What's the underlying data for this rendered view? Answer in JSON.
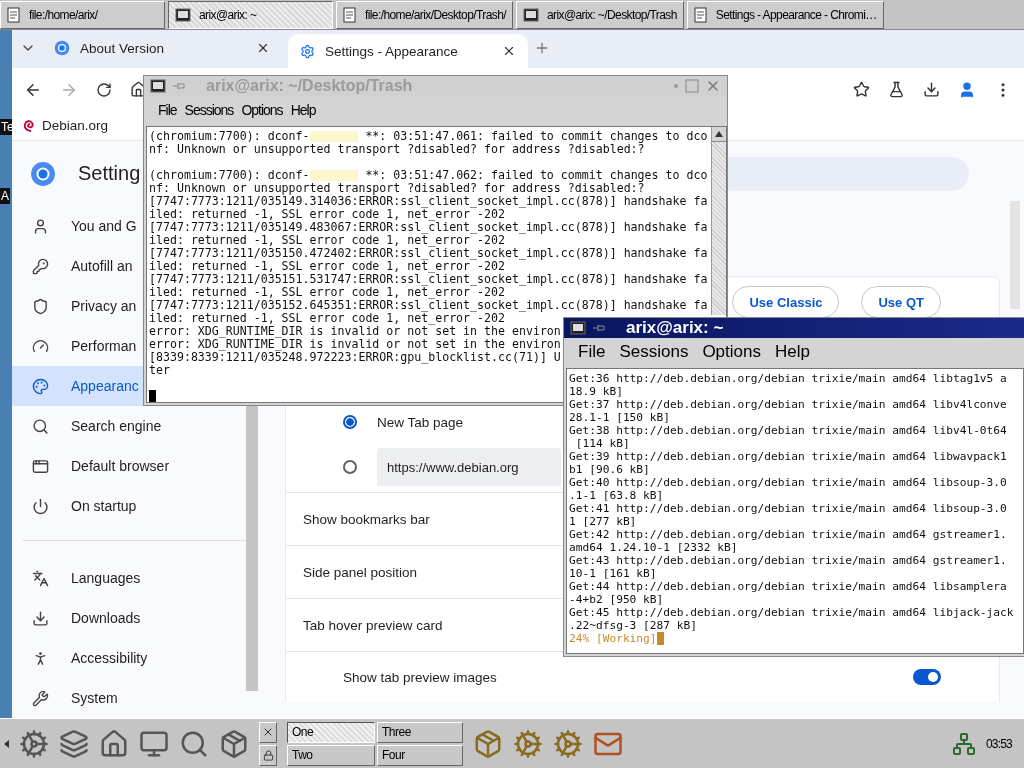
{
  "taskbar_top": {
    "tasks": [
      {
        "label": "file:/home/arix/",
        "selected": false
      },
      {
        "label": "arix@arix: ~",
        "selected": true
      },
      {
        "label": "file:/home/arix/Desktop/Trash/",
        "selected": false
      },
      {
        "label": "arix@arix: ~/Desktop/Trash",
        "selected": false
      },
      {
        "label": "Settings - Appearance - Chromi…",
        "selected": false
      }
    ]
  },
  "desktop_labels": [
    "Te",
    "A"
  ],
  "browser": {
    "tabs": [
      {
        "label": "About Version",
        "selected": false
      },
      {
        "label": "Settings - Appearance",
        "selected": true
      }
    ],
    "bookmarks": [
      "Debian.org"
    ],
    "settings": {
      "title": "Setting",
      "sidebar": [
        {
          "label": "You and G",
          "selected": false
        },
        {
          "label": "Autofill an",
          "selected": false
        },
        {
          "label": "Privacy an",
          "selected": false
        },
        {
          "label": "Performan",
          "selected": false
        },
        {
          "label": "Appearanc",
          "selected": true
        },
        {
          "label": "Search engine",
          "selected": false
        },
        {
          "label": "Default browser",
          "selected": false
        },
        {
          "label": "On startup",
          "selected": false
        },
        {
          "label": "Languages",
          "selected": false
        },
        {
          "label": "Downloads",
          "selected": false
        },
        {
          "label": "Accessibility",
          "selected": false
        },
        {
          "label": "System",
          "selected": false
        }
      ],
      "theme_buttons": [
        "Use Classic",
        "Use QT"
      ],
      "startup_options": [
        {
          "kind": "preset",
          "label": "New Tab page",
          "selected": true
        },
        {
          "kind": "url",
          "value": "https://www.debian.org",
          "selected": false
        }
      ],
      "rows": [
        {
          "kind": "plain",
          "label": "Show bookmarks bar"
        },
        {
          "kind": "plain",
          "label": "Side panel position"
        },
        {
          "kind": "plain",
          "label": "Tab hover preview card"
        },
        {
          "kind": "toggle",
          "label": "Show tab preview images",
          "on": true
        }
      ]
    }
  },
  "terminals": [
    {
      "title": "arix@arix: ~/Desktop/Trash",
      "active": false,
      "menu": [
        "File",
        "Sessions",
        "Options",
        "Help"
      ],
      "lines": [
        {
          "kind": "redacted",
          "before": "(chromium:7700): dconf-",
          "after": " **: 03:51:47.061: failed to commit changes to dco"
        },
        {
          "kind": "plain",
          "text": "nf: Unknown or unsupported transport ?disabled? for address ?disabled:?"
        },
        {
          "kind": "blank"
        },
        {
          "kind": "redacted",
          "before": "(chromium:7700): dconf-",
          "after": " **: 03:51:47.062: failed to commit changes to dco"
        },
        {
          "kind": "plain",
          "text": "nf: Unknown or unsupported transport ?disabled? for address ?disabled:?"
        },
        {
          "kind": "plain",
          "text": "[7747:7773:1211/035149.314036:ERROR:ssl_client_socket_impl.cc(878)] handshake fa"
        },
        {
          "kind": "plain",
          "text": "iled: returned -1, SSL error code 1, net_error -202"
        },
        {
          "kind": "plain",
          "text": "[7747:7773:1211/035149.483067:ERROR:ssl_client_socket_impl.cc(878)] handshake fa"
        },
        {
          "kind": "plain",
          "text": "iled: returned -1, SSL error code 1, net_error -202"
        },
        {
          "kind": "plain",
          "text": "[7747:7773:1211/035150.472402:ERROR:ssl_client_socket_impl.cc(878)] handshake fa"
        },
        {
          "kind": "plain",
          "text": "iled: returned -1, SSL error code 1, net_error -202"
        },
        {
          "kind": "plain",
          "text": "[7747:7773:1211/035151.531747:ERROR:ssl_client_socket_impl.cc(878)] handshake fa"
        },
        {
          "kind": "plain",
          "text": "iled: returned -1, SSL error code 1, net_error -202"
        },
        {
          "kind": "plain",
          "text": "[7747:7773:1211/035152.645351:ERROR:ssl_client_socket_impl.cc(878)] handshake fa"
        },
        {
          "kind": "plain",
          "text": "iled: returned -1, SSL error code 1, net_error -202"
        },
        {
          "kind": "plain",
          "text": "error: XDG_RUNTIME_DIR is invalid or not set in the environ"
        },
        {
          "kind": "plain",
          "text": "error: XDG_RUNTIME_DIR is invalid or not set in the environ"
        },
        {
          "kind": "plain",
          "text": "[8339:8339:1211/035248.972223:ERROR:gpu_blocklist.cc(71)] U"
        },
        {
          "kind": "plain",
          "text": "ter"
        },
        {
          "kind": "blank"
        },
        {
          "kind": "cursor"
        }
      ]
    },
    {
      "title": "arix@arix: ~",
      "active": true,
      "menu": [
        "File",
        "Sessions",
        "Options",
        "Help"
      ],
      "lines": [
        {
          "kind": "plain",
          "text": "Get:36 http://deb.debian.org/debian trixie/main amd64 libtag1v5 a"
        },
        {
          "kind": "plain",
          "text": "18.9 kB]"
        },
        {
          "kind": "plain",
          "text": "Get:37 http://deb.debian.org/debian trixie/main amd64 libv4lconve"
        },
        {
          "kind": "plain",
          "text": "28.1-1 [150 kB]"
        },
        {
          "kind": "plain",
          "text": "Get:38 http://deb.debian.org/debian trixie/main amd64 libv4l-0t64"
        },
        {
          "kind": "plain",
          "text": " [114 kB]"
        },
        {
          "kind": "plain",
          "text": "Get:39 http://deb.debian.org/debian trixie/main amd64 libwavpack1"
        },
        {
          "kind": "plain",
          "text": "b1 [90.6 kB]"
        },
        {
          "kind": "plain",
          "text": "Get:40 http://deb.debian.org/debian trixie/main amd64 libsoup-3.0"
        },
        {
          "kind": "plain",
          "text": ".1-1 [63.8 kB]"
        },
        {
          "kind": "plain",
          "text": "Get:41 http://deb.debian.org/debian trixie/main amd64 libsoup-3.0"
        },
        {
          "kind": "plain",
          "text": "1 [277 kB]"
        },
        {
          "kind": "plain",
          "text": "Get:42 http://deb.debian.org/debian trixie/main amd64 gstreamer1."
        },
        {
          "kind": "plain",
          "text": "amd64 1.24.10-1 [2332 kB]"
        },
        {
          "kind": "plain",
          "text": "Get:43 http://deb.debian.org/debian trixie/main amd64 gstreamer1."
        },
        {
          "kind": "plain",
          "text": "10-1 [161 kB]"
        },
        {
          "kind": "plain",
          "text": "Get:44 http://deb.debian.org/debian trixie/main amd64 libsamplera"
        },
        {
          "kind": "plain",
          "text": "-4+b2 [950 kB]"
        },
        {
          "kind": "plain",
          "text": "Get:45 http://deb.debian.org/debian trixie/main amd64 libjack-jack"
        },
        {
          "kind": "plain",
          "text": ".22~dfsg-3 [287 kB]"
        },
        {
          "kind": "status",
          "text": "24% [Working]"
        }
      ]
    }
  ],
  "taskbar_bottom": {
    "pager": [
      {
        "label": "One",
        "selected": true
      },
      {
        "label": "Three",
        "selected": false
      },
      {
        "label": "Two",
        "selected": false
      },
      {
        "label": "Four",
        "selected": false
      }
    ],
    "clock": "03:53"
  }
}
